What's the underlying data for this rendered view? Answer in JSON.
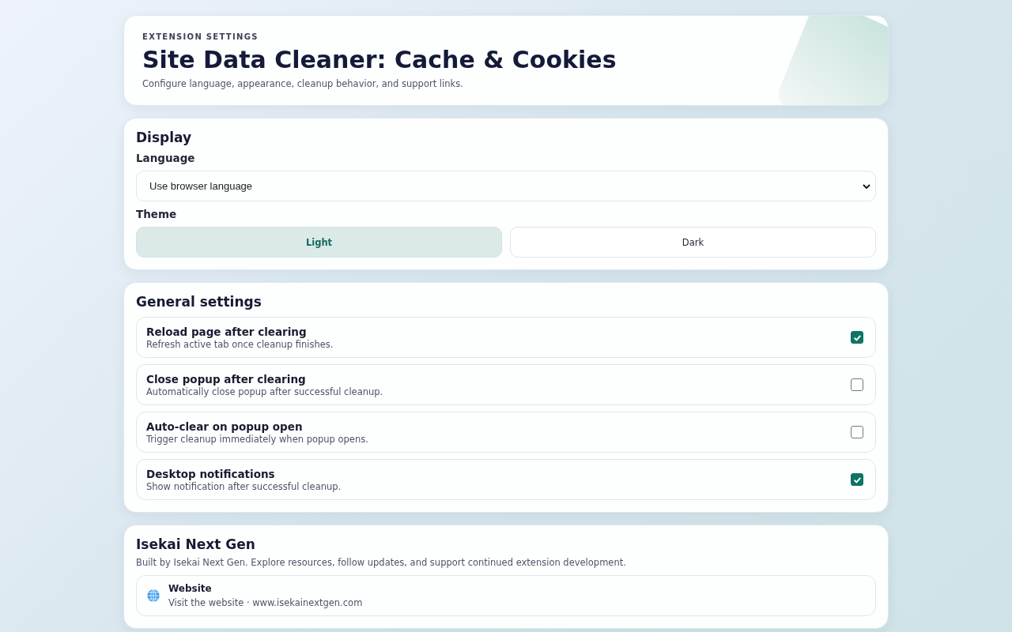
{
  "header": {
    "eyebrow": "EXTENSION SETTINGS",
    "title": "Site Data Cleaner: Cache & Cookies",
    "subtitle": "Configure language, appearance, cleanup behavior, and support links."
  },
  "display": {
    "title": "Display",
    "language_label": "Language",
    "language_value": "Use browser language",
    "theme_label": "Theme",
    "themes": [
      {
        "label": "Light",
        "selected": true
      },
      {
        "label": "Dark",
        "selected": false
      }
    ]
  },
  "general": {
    "title": "General settings",
    "options": [
      {
        "title": "Reload page after clearing",
        "description": "Refresh active tab once cleanup finishes.",
        "checked": true
      },
      {
        "title": "Close popup after clearing",
        "description": "Automatically close popup after successful cleanup.",
        "checked": false
      },
      {
        "title": "Auto-clear on popup open",
        "description": "Trigger cleanup immediately when popup opens.",
        "checked": false
      },
      {
        "title": "Desktop notifications",
        "description": "Show notification after successful cleanup.",
        "checked": true
      }
    ]
  },
  "about": {
    "title": "Isekai Next Gen",
    "description": "Built by Isekai Next Gen. Explore resources, follow updates, and support continued extension development.",
    "links": [
      {
        "title": "Website",
        "description": "Visit the website · www.isekainextgen.com"
      }
    ]
  }
}
